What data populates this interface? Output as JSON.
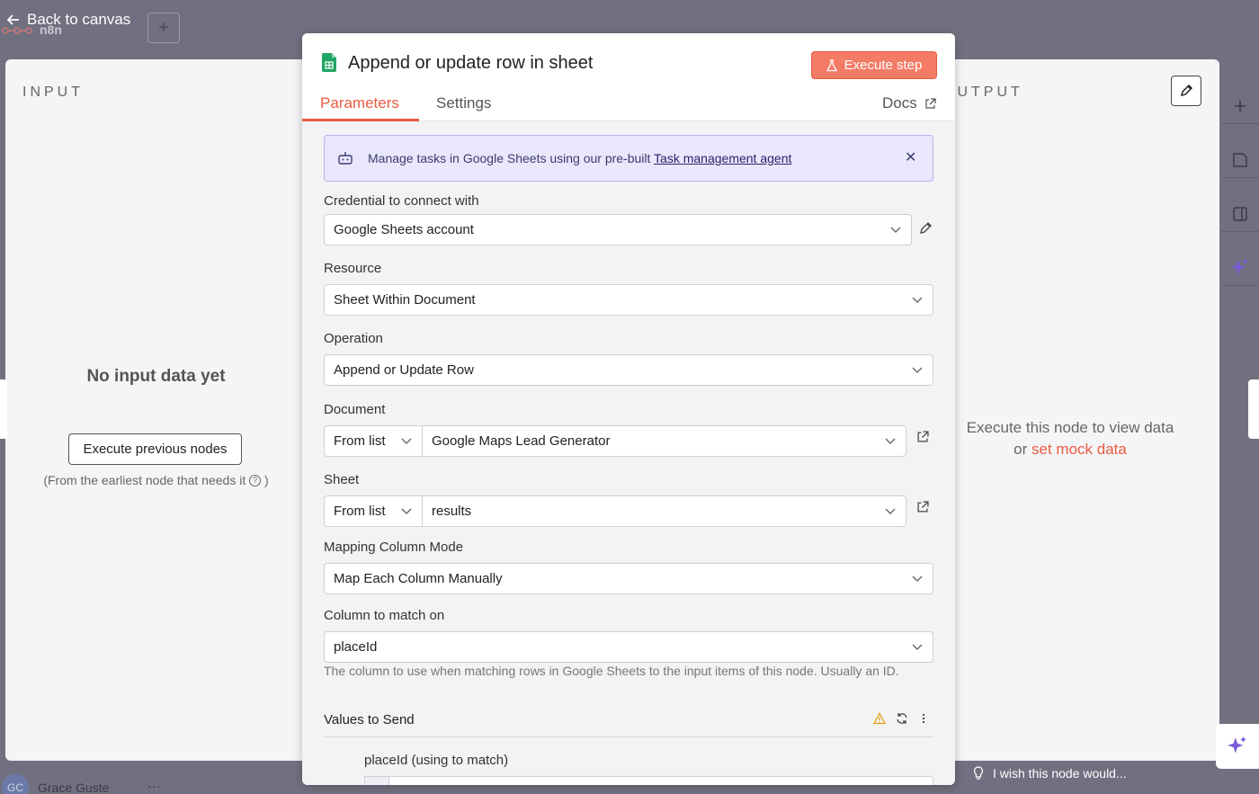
{
  "topbar": {
    "back_label": "Back to canvas",
    "brand": "n8n",
    "add_symbol": "+"
  },
  "user": {
    "initials": "GC",
    "name": "Grace Guste",
    "more": "…"
  },
  "input_panel": {
    "title": "INPUT",
    "empty_title": "No input data yet",
    "exec_prev_label": "Execute previous nodes",
    "hint": "(From the earliest node that needs it",
    "hint_close": ")"
  },
  "output_panel": {
    "title": "OUTPUT",
    "message_line1": "Execute this node to view data",
    "message_or": "or",
    "mock_link": "set mock data"
  },
  "wish_label": "I wish this node would...",
  "node": {
    "title": "Append or update row in sheet",
    "execute_label": "Execute step",
    "tabs": [
      "Parameters",
      "Settings"
    ],
    "docs_label": "Docs",
    "accent": "#ea5b41"
  },
  "banner": {
    "text": "Manage tasks in Google Sheets using our pre-built",
    "link": "Task management agent"
  },
  "fields": {
    "credential": {
      "label": "Credential to connect with",
      "value": "Google Sheets account"
    },
    "resource": {
      "label": "Resource",
      "value": "Sheet Within Document"
    },
    "operation": {
      "label": "Operation",
      "value": "Append or Update Row"
    },
    "document": {
      "label": "Document",
      "mode": "From list",
      "value": "Google Maps Lead Generator"
    },
    "sheet": {
      "label": "Sheet",
      "mode": "From list",
      "value": "results"
    },
    "mapping": {
      "label": "Mapping Column Mode",
      "value": "Map Each Column Manually"
    },
    "match": {
      "label": "Column to match on",
      "value": "placeId",
      "hint": "The column to use when matching rows in Google Sheets to the input items of this node. Usually an ID."
    },
    "values": {
      "title": "Values to Send",
      "first_field": "placeId (using to match)"
    }
  }
}
